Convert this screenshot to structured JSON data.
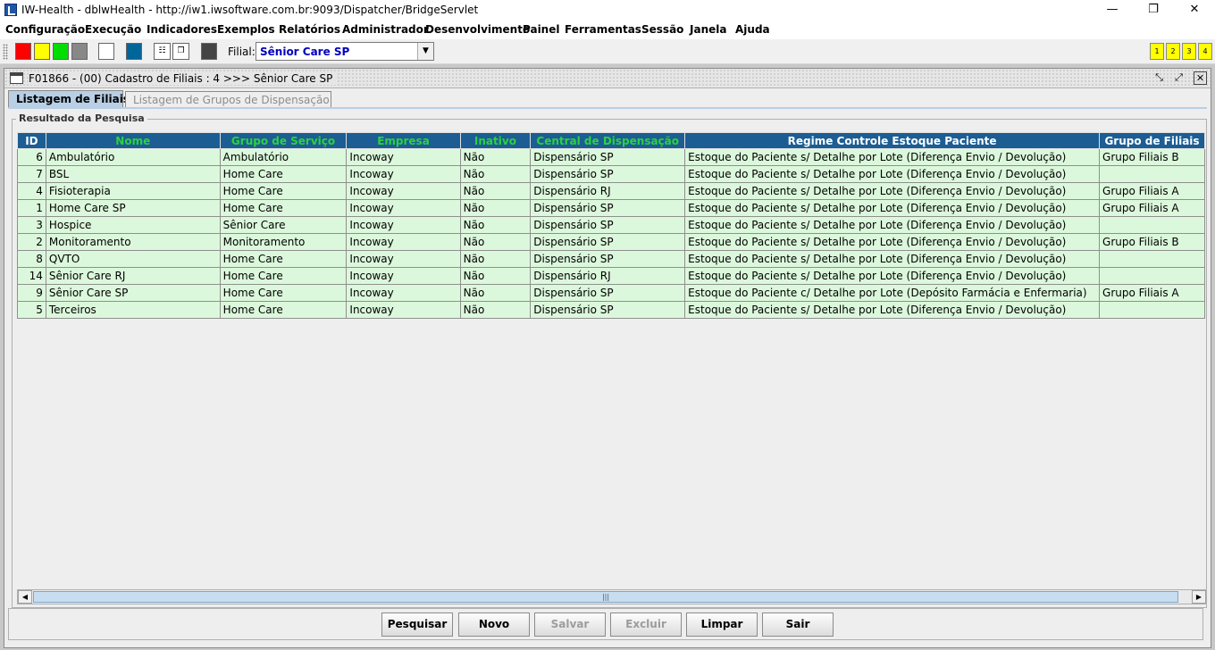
{
  "window": {
    "title": "IW-Health - dblwHealth - http://iw1.iwsoftware.com.br:9093/Dispatcher/BridgeServlet",
    "minimize": "—",
    "maximize": "❐",
    "close": "✕"
  },
  "menu": [
    "Configuração",
    "Execução",
    "Indicadores",
    "Exemplos",
    "Relatórios",
    "Administrador",
    "Desenvolvimento",
    "Painel",
    "Ferramentas",
    "Sessão",
    "Janela",
    "Ajuda"
  ],
  "toolbar": {
    "colors": [
      "#ff0000",
      "#ffff00",
      "#00dd00",
      "#888888",
      "#ffffff",
      "#006699",
      "#444444"
    ],
    "filial_label": "Filial:",
    "filial_value": "Sênior Care SP",
    "numbers": [
      "1",
      "2",
      "3",
      "4"
    ]
  },
  "frame": {
    "title": "F01866 - (00) Cadastro de Filiais : 4 >>> Sênior Care SP",
    "tabs": [
      "Listagem de  Filiais",
      "Listagem de Grupos de Dispensação"
    ],
    "group_label": "Resultado da Pesquisa"
  },
  "table": {
    "columns": [
      "ID",
      "Nome",
      "Grupo de Serviço",
      "Empresa",
      "Inativo",
      "Central de Dispensação",
      "Regime Controle Estoque Paciente",
      "Grupo de Filiais"
    ],
    "rows": [
      [
        "6",
        "Ambulatório",
        "Ambulatório",
        "Incoway",
        "Não",
        "Dispensário SP",
        "Estoque do Paciente s/ Detalhe por Lote (Diferença Envio / Devolução)",
        "Grupo Filiais B"
      ],
      [
        "7",
        "BSL",
        "Home Care",
        "Incoway",
        "Não",
        "Dispensário SP",
        "Estoque do Paciente s/ Detalhe por Lote (Diferença Envio / Devolução)",
        ""
      ],
      [
        "4",
        "Fisioterapia",
        "Home Care",
        "Incoway",
        "Não",
        "Dispensário RJ",
        "Estoque do Paciente s/ Detalhe por Lote (Diferença Envio / Devolução)",
        "Grupo Filiais A"
      ],
      [
        "1",
        "Home Care SP",
        "Home Care",
        "Incoway",
        "Não",
        "Dispensário SP",
        "Estoque do Paciente s/ Detalhe por Lote (Diferença Envio / Devolução)",
        "Grupo Filiais A"
      ],
      [
        "3",
        "Hospice",
        "Sênior Care",
        "Incoway",
        "Não",
        "Dispensário SP",
        "Estoque do Paciente s/ Detalhe por Lote (Diferença Envio / Devolução)",
        ""
      ],
      [
        "2",
        "Monitoramento",
        "Monitoramento",
        "Incoway",
        "Não",
        "Dispensário SP",
        "Estoque do Paciente s/ Detalhe por Lote (Diferença Envio / Devolução)",
        "Grupo Filiais B"
      ],
      [
        "8",
        "QVTO",
        "Home Care",
        "Incoway",
        "Não",
        "Dispensário SP",
        "Estoque do Paciente s/ Detalhe por Lote (Diferença Envio / Devolução)",
        ""
      ],
      [
        "14",
        "Sênior Care RJ",
        "Home Care",
        "Incoway",
        "Não",
        "Dispensário RJ",
        "Estoque do Paciente s/ Detalhe por Lote (Diferença Envio / Devolução)",
        ""
      ],
      [
        "9",
        "Sênior Care SP",
        "Home Care",
        "Incoway",
        "Não",
        "Dispensário SP",
        "Estoque do Paciente c/ Detalhe por Lote (Depósito Farmácia e Enfermaria)",
        "Grupo Filiais A"
      ],
      [
        "5",
        "Terceiros",
        "Home Care",
        "Incoway",
        "Não",
        "Dispensário SP",
        "Estoque do Paciente s/ Detalhe por Lote (Diferença Envio / Devolução)",
        ""
      ]
    ]
  },
  "buttons": {
    "pesquisar": "Pesquisar",
    "novo": "Novo",
    "salvar": "Salvar",
    "excluir": "Excluir",
    "limpar": "Limpar",
    "sair": "Sair"
  }
}
